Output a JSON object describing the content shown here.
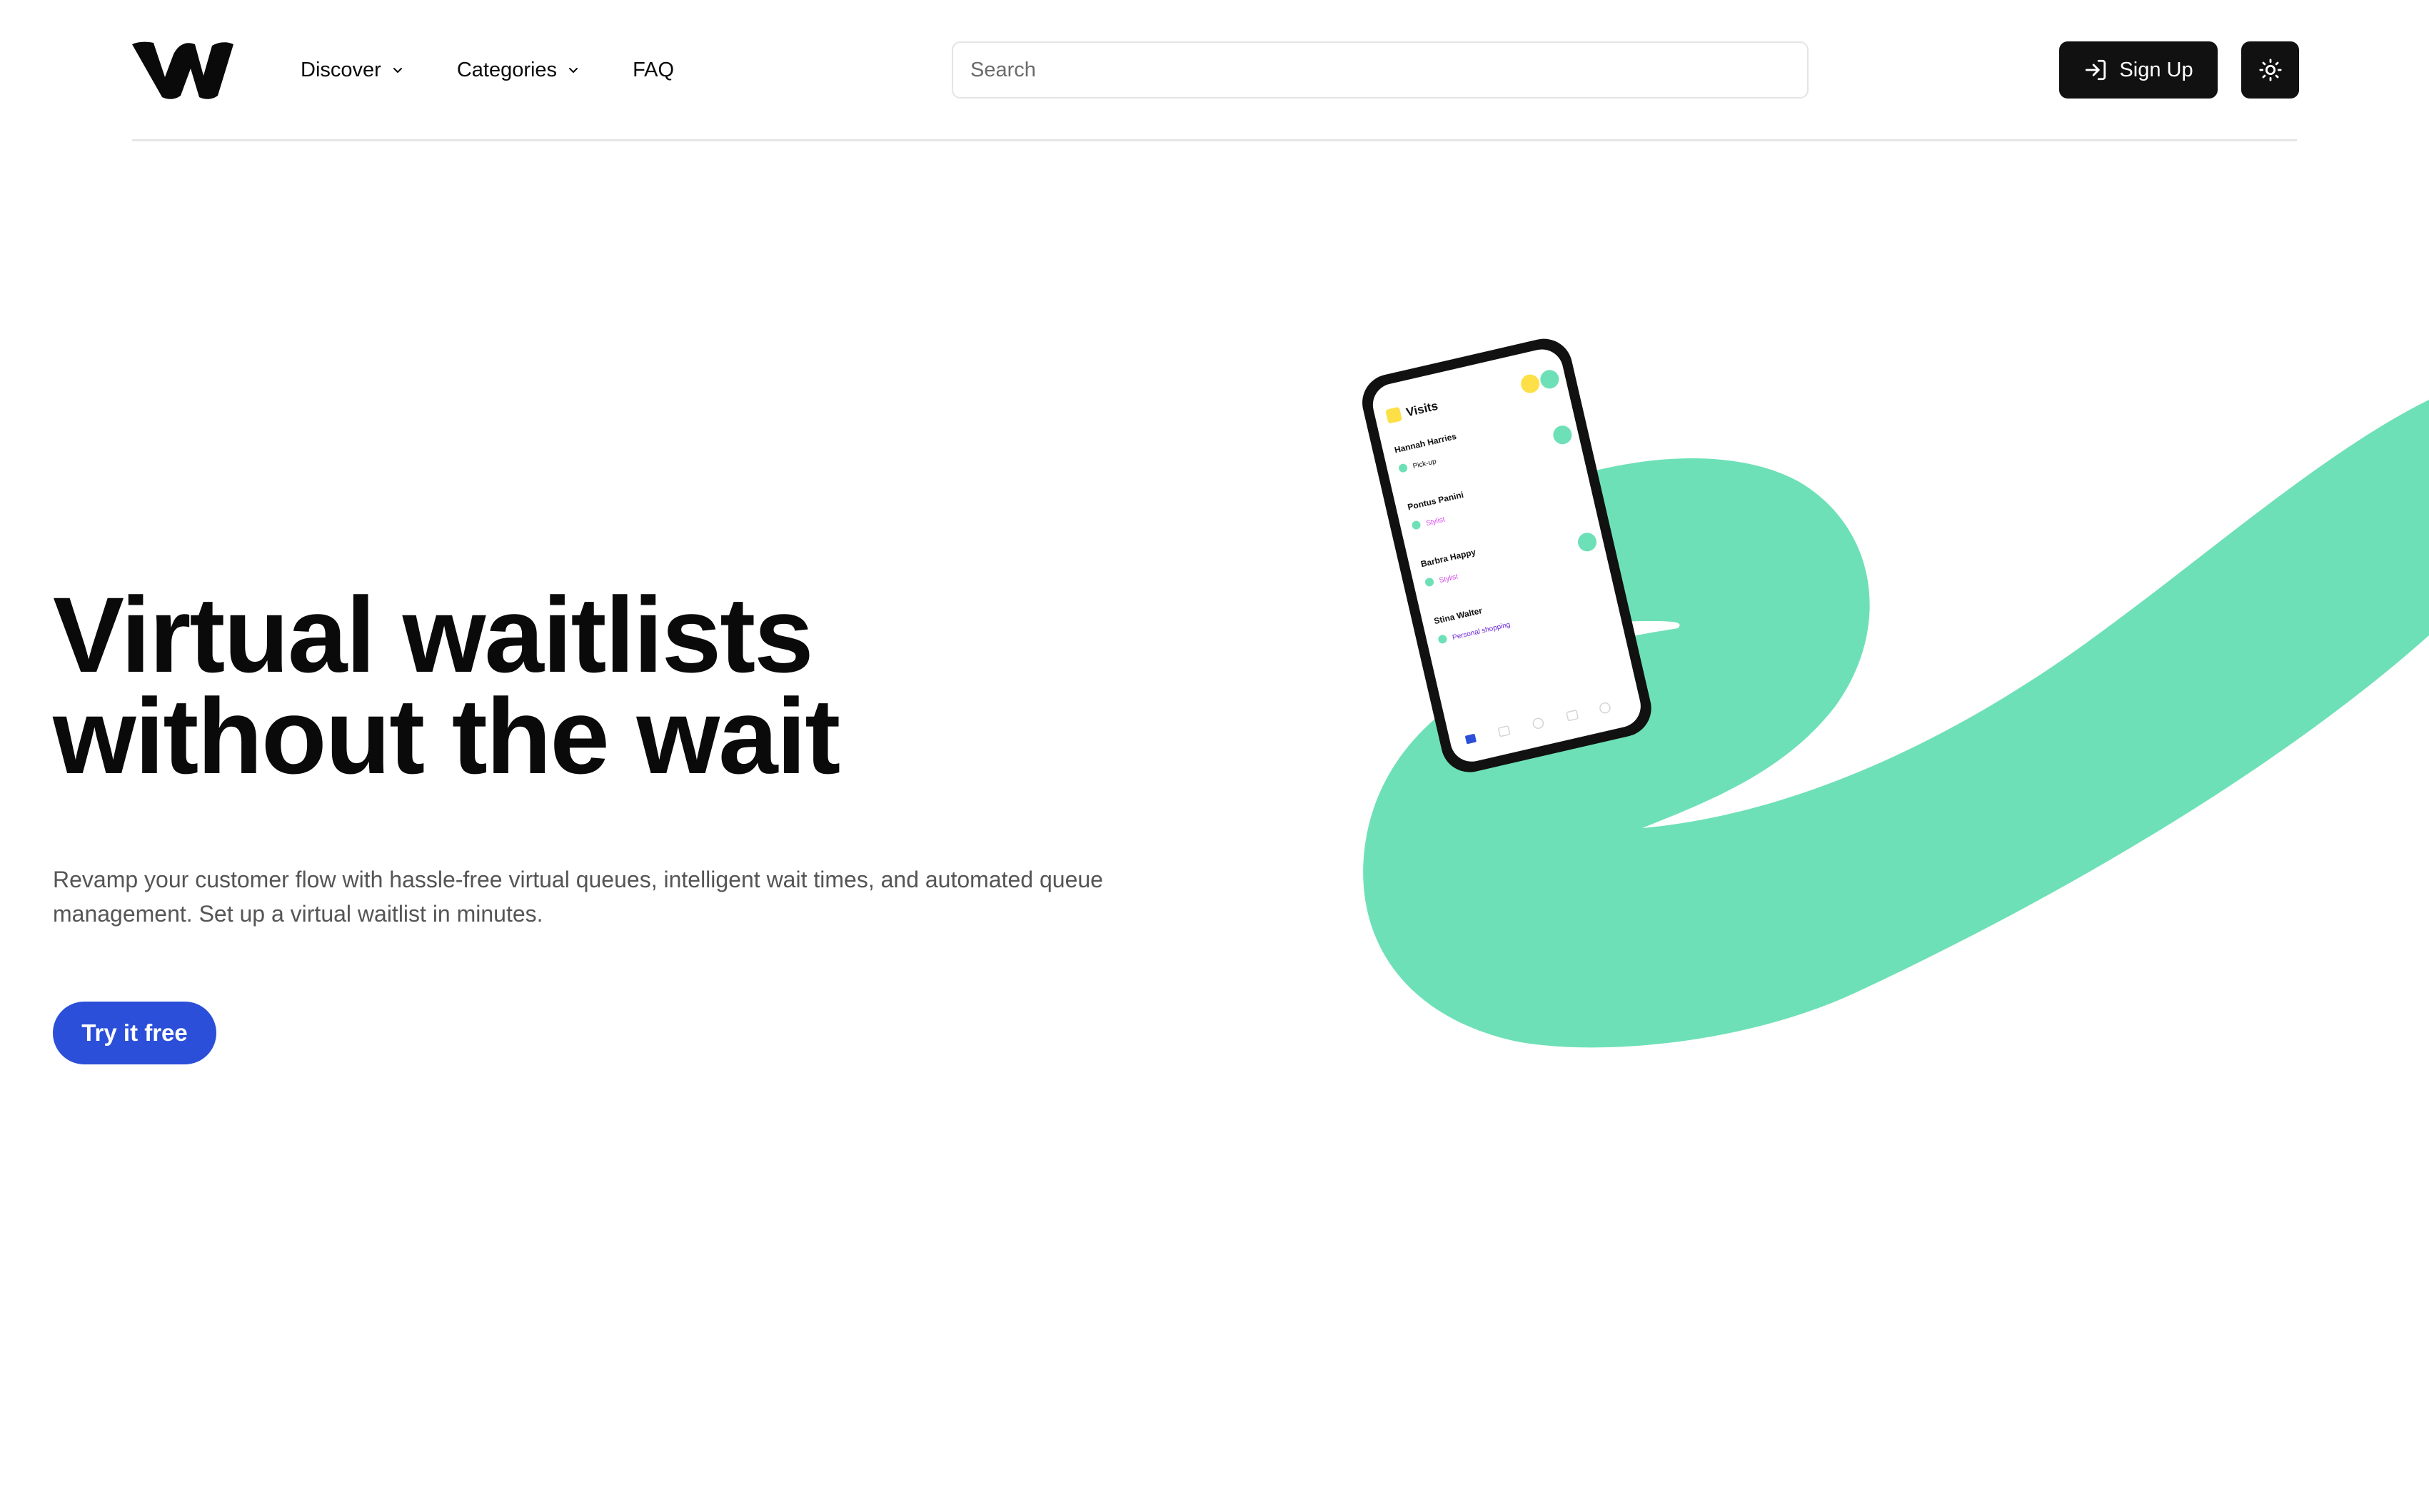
{
  "header": {
    "logo_name": "w-logo",
    "nav": {
      "discover": "Discover",
      "categories": "Categories",
      "faq": "FAQ"
    },
    "search": {
      "placeholder": "Search",
      "value": ""
    },
    "signup_label": "Sign Up"
  },
  "hero": {
    "title_line1": "Virtual waitlists",
    "title_line2": "without the wait",
    "subtitle": "Revamp your customer flow with hassle-free virtual queues, intelligent wait times, and automated queue management. Set up a virtual waitlist in minutes.",
    "cta_label": "Try it free"
  },
  "phone": {
    "title": "Visits",
    "items": [
      {
        "name": "Hannah Harries",
        "tag": "Pick-up",
        "tag_color": "#111111"
      },
      {
        "name": "Pontus Panini",
        "tag": "Stylist",
        "tag_color": "#d946ef"
      },
      {
        "name": "Barbra Happy",
        "tag": "Stylist",
        "tag_color": "#d946ef"
      },
      {
        "name": "Stina Walter",
        "tag": "Personal shopping",
        "tag_color": "#6d28d9"
      }
    ]
  },
  "colors": {
    "accent": "#2b4fd8",
    "mint": "#6ee0b7",
    "dark": "#111111",
    "yellow": "#fde047",
    "hand": "#fdf6e6"
  }
}
